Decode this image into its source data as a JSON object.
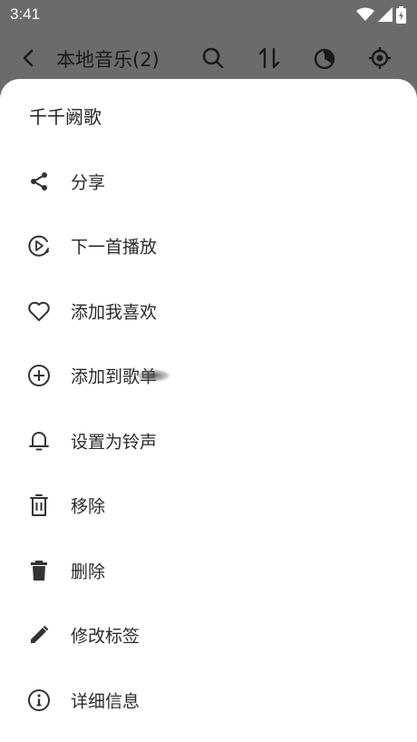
{
  "status_bar": {
    "time": "3:41",
    "icons": [
      "wifi-icon",
      "signal-icon",
      "battery-icon"
    ]
  },
  "app_bar": {
    "title": "本地音乐(2)",
    "actions": [
      "back-icon",
      "search-icon",
      "sort-icon",
      "timer-icon",
      "locate-icon"
    ]
  },
  "sheet": {
    "title": "千千阙歌",
    "items": [
      {
        "label": "分享",
        "icon": "share-icon"
      },
      {
        "label": "下一首播放",
        "icon": "play-next-icon"
      },
      {
        "label": "添加我喜欢",
        "icon": "heart-icon"
      },
      {
        "label": "添加到歌单",
        "icon": "add-circle-icon"
      },
      {
        "label": "设置为铃声",
        "icon": "bell-icon"
      },
      {
        "label": "移除",
        "icon": "trash-outline-icon"
      },
      {
        "label": "删除",
        "icon": "trash-filled-icon"
      },
      {
        "label": "修改标签",
        "icon": "pencil-icon"
      },
      {
        "label": "详细信息",
        "icon": "info-icon"
      }
    ]
  },
  "colors": {
    "scrim": "#6b6b6b",
    "sheet_bg": "#ffffff",
    "text": "#2a2a2a",
    "icon": "#333333"
  }
}
